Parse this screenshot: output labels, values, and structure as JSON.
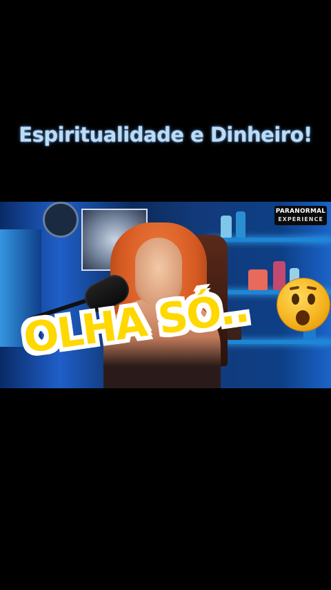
{
  "title": "Espiritualidade e Dinheiro!",
  "video": {
    "logo_top": "PARANORMAL",
    "logo_bottom": "EXPERIENCE",
    "caption": "OLHA SÓ..",
    "emoji_icon": "astonished-face-icon"
  },
  "colors": {
    "title": "#bcdcf6",
    "caption_fill": "#ffd800",
    "caption_outline": "#ffffff",
    "background": "#000000"
  }
}
